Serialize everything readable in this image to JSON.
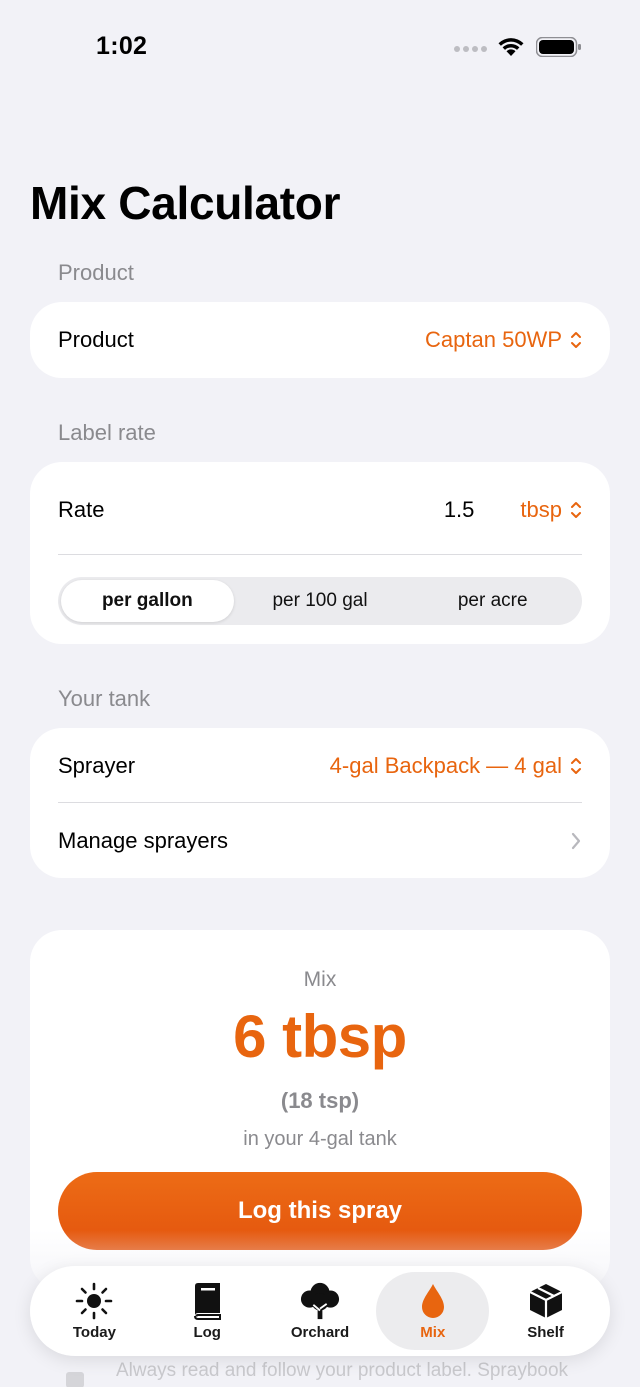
{
  "status_bar": {
    "time": "1:02"
  },
  "page": {
    "title": "Mix Calculator"
  },
  "product_section": {
    "header": "Product",
    "label": "Product",
    "value": "Captan 50WP"
  },
  "rate_section": {
    "header": "Label rate",
    "label": "Rate",
    "amount": "1.5",
    "unit": "tbsp",
    "segments": [
      "per gallon",
      "per 100 gal",
      "per acre"
    ],
    "selected_segment": "per gallon"
  },
  "tank_section": {
    "header": "Your tank",
    "sprayer_label": "Sprayer",
    "sprayer_value": "4-gal Backpack — 4 gal",
    "manage_label": "Manage sprayers"
  },
  "result": {
    "label": "Mix",
    "value": "6 tbsp",
    "sub": "(18 tsp)",
    "tank_note": "in your 4-gal tank",
    "button_label": "Log this spray"
  },
  "disclaimer": "Always read and follow your product label. Spraybook",
  "tabs": [
    {
      "label": "Today",
      "icon": "sun-icon"
    },
    {
      "label": "Log",
      "icon": "book-icon"
    },
    {
      "label": "Orchard",
      "icon": "tree-icon"
    },
    {
      "label": "Mix",
      "icon": "drop-icon"
    },
    {
      "label": "Shelf",
      "icon": "box-icon"
    }
  ],
  "active_tab": "Mix",
  "colors": {
    "accent": "#e8650f",
    "background": "#f2f2f7",
    "secondary_text": "#8a8a8e"
  }
}
